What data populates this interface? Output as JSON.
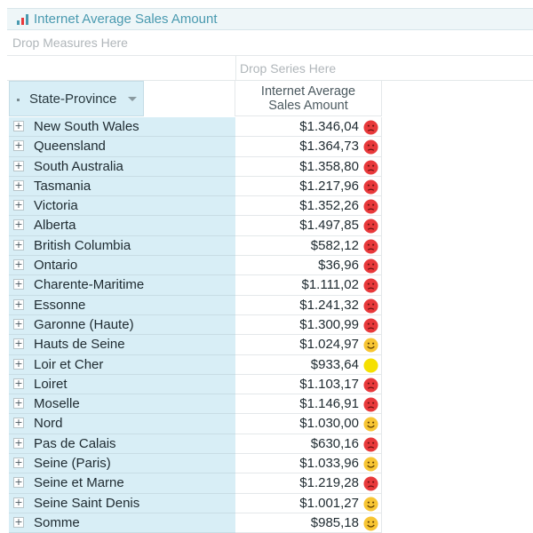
{
  "title": "Internet Average Sales Amount",
  "drop_measures": "Drop Measures Here",
  "drop_series": "Drop Series Here",
  "row_header": "State-Province",
  "column_header_line1": "Internet Average",
  "column_header_line2": "Sales Amount",
  "expand_symbol": "+",
  "colors": {
    "bad": "#e8393b",
    "warning_yellow": "#f5e000",
    "neutral": "#f7c533"
  },
  "rows": [
    {
      "state": "New South Wales",
      "amount": "$1.346,04",
      "status": "bad"
    },
    {
      "state": "Queensland",
      "amount": "$1.364,73",
      "status": "bad"
    },
    {
      "state": "South Australia",
      "amount": "$1.358,80",
      "status": "bad"
    },
    {
      "state": "Tasmania",
      "amount": "$1.217,96",
      "status": "bad"
    },
    {
      "state": "Victoria",
      "amount": "$1.352,26",
      "status": "bad"
    },
    {
      "state": "Alberta",
      "amount": "$1.497,85",
      "status": "bad"
    },
    {
      "state": "British Columbia",
      "amount": "$582,12",
      "status": "bad"
    },
    {
      "state": "Ontario",
      "amount": "$36,96",
      "status": "bad"
    },
    {
      "state": "Charente-Maritime",
      "amount": "$1.111,02",
      "status": "bad"
    },
    {
      "state": "Essonne",
      "amount": "$1.241,32",
      "status": "bad"
    },
    {
      "state": "Garonne (Haute)",
      "amount": "$1.300,99",
      "status": "bad"
    },
    {
      "state": "Hauts de Seine",
      "amount": "$1.024,97",
      "status": "good"
    },
    {
      "state": "Loir et Cher",
      "amount": "$933,64",
      "status": "neutral"
    },
    {
      "state": "Loiret",
      "amount": "$1.103,17",
      "status": "bad"
    },
    {
      "state": "Moselle",
      "amount": "$1.146,91",
      "status": "bad"
    },
    {
      "state": "Nord",
      "amount": "$1.030,00",
      "status": "good"
    },
    {
      "state": "Pas de Calais",
      "amount": "$630,16",
      "status": "bad"
    },
    {
      "state": "Seine (Paris)",
      "amount": "$1.033,96",
      "status": "good"
    },
    {
      "state": "Seine et Marne",
      "amount": "$1.219,28",
      "status": "bad"
    },
    {
      "state": "Seine Saint Denis",
      "amount": "$1.001,27",
      "status": "good"
    },
    {
      "state": "Somme",
      "amount": "$985,18",
      "status": "good"
    }
  ]
}
